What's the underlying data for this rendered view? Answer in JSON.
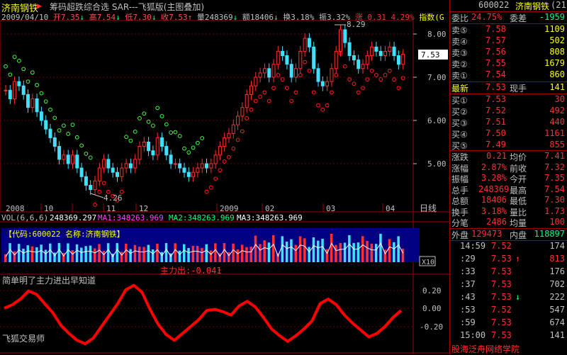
{
  "header": {
    "stock_name": "济南钢铁",
    "formula": "筹码超跌综合选 SAR---飞狐版(主图叠加)",
    "date": "2009/04/10",
    "open": "开7.35",
    "high": "高7.54",
    "low": "低7.30",
    "close": "收7.53",
    "volume": "量248369",
    "amount": "额18406",
    "turnover": "换3.18%",
    "amplitude": "振3.32%",
    "change": "涨 0.31 4.29%",
    "index": "指数(G"
  },
  "main_chart": {
    "ylabels": [
      "8.00",
      "7.00",
      "6.00",
      "5.00"
    ],
    "high_annotation": "8.29",
    "low_annotation": "4.26",
    "price_tag": "7.53",
    "x_labels": [
      "2008",
      "10",
      "11",
      "12",
      "2009",
      "02",
      "03",
      "04"
    ],
    "x_unit": "日线"
  },
  "volume_panel": {
    "title": "VOL(6,6,6)",
    "vol": "248369.297",
    "ma1": "MA1:348263.969",
    "ma2": "MA2:348263.969",
    "ma3": "MA3:348263.969",
    "code_label": "【代码:600022 名称:济南钢铁】",
    "scale": "X10"
  },
  "indicator_panel": {
    "title": "简单明了主力进出早知道",
    "value_label": "主力出:-0.041",
    "ylabels": [
      "0.20",
      "0.00",
      "-0.20"
    ],
    "footer": "飞狐交易师"
  },
  "chart_data": [
    {
      "type": "line",
      "title": "主力出",
      "y": [
        0.06,
        0.09,
        0.14,
        0.21,
        0.18,
        0.1,
        0.02,
        -0.09,
        -0.16,
        -0.22,
        -0.25,
        -0.2,
        -0.1,
        0.0,
        0.1,
        0.22,
        0.26,
        0.2,
        0.05,
        -0.08,
        -0.17,
        -0.22,
        -0.16,
        -0.1,
        -0.04,
        0.04,
        0.05,
        0.03,
        0.0,
        0.08,
        0.12,
        0.07,
        -0.02,
        -0.12,
        -0.18,
        -0.23,
        -0.18,
        -0.12,
        -0.05,
        0.1,
        0.14,
        0.09,
        0.0,
        -0.07,
        -0.13,
        -0.19,
        -0.16,
        -0.1,
        -0.02,
        0.04
      ],
      "ylim": [
        -0.28,
        0.35
      ]
    }
  ],
  "quote": {
    "code": "600022",
    "name": "济南钢铁",
    "num": "(21)",
    "webi_label": "委比",
    "webi_value": "24.75%",
    "wecha_label": "委差",
    "wecha_value": "-1959",
    "asks": [
      {
        "label": "卖⑤",
        "price": "7.58",
        "vol": "1109"
      },
      {
        "label": "卖④",
        "price": "7.57",
        "vol": "502"
      },
      {
        "label": "卖③",
        "price": "7.56",
        "vol": "808"
      },
      {
        "label": "卖②",
        "price": "7.55",
        "vol": "1679"
      },
      {
        "label": "卖①",
        "price": "7.54",
        "vol": "860"
      }
    ],
    "latest_label": "最新",
    "latest": "7.53",
    "hand_label": "现手",
    "hand": "141",
    "bids": [
      {
        "label": "买①",
        "price": "7.53",
        "vol": "30"
      },
      {
        "label": "买②",
        "price": "7.52",
        "vol": "492"
      },
      {
        "label": "买③",
        "price": "7.51",
        "vol": "440"
      },
      {
        "label": "买④",
        "price": "7.50",
        "vol": "1161"
      },
      {
        "label": "买⑤",
        "price": "7.49",
        "vol": "855"
      }
    ],
    "stats": [
      {
        "l1": "涨跌",
        "v1": "0.21",
        "l2": "均价",
        "v2": "7.41"
      },
      {
        "l1": "涨幅",
        "v1": "2.87%",
        "l2": "前收",
        "v2": "7.32"
      },
      {
        "l1": "振幅",
        "v1": "3.28%",
        "l2": "今开",
        "v2": "7.35"
      },
      {
        "l1": "总手",
        "v1": "248369",
        "l2": "最高",
        "v2": "7.54"
      },
      {
        "l1": "总额",
        "v1": "18406",
        "l2": "最低",
        "v2": "7.30"
      },
      {
        "l1": "换手",
        "v1": "3.18%",
        "l2": "量比",
        "v2": "1.73"
      },
      {
        "l1": "分笔",
        "v1": "2486",
        "l2": "均量",
        "v2": "100"
      }
    ],
    "outer_label": "外盘",
    "outer": "129473",
    "inner_label": "内盘",
    "inner": "118897",
    "ticks": [
      {
        "time": "14:59",
        "price": "7.52",
        "vol": "174",
        "arrow": ""
      },
      {
        "time": ":29",
        "price": "7.53",
        "vol": "813",
        "arrow": "↑"
      },
      {
        "time": ":33",
        "price": "7.53",
        "vol": "176",
        "arrow": ""
      },
      {
        "time": ":37",
        "price": "7.53",
        "vol": "702",
        "arrow": ""
      },
      {
        "time": ":43",
        "price": "7.53",
        "vol": "222",
        "arrow": "↓"
      },
      {
        "time": ":53",
        "price": "7.52",
        "vol": "547",
        "arrow": ""
      },
      {
        "time": ":59",
        "price": "7.53",
        "vol": "674",
        "arrow": ""
      },
      {
        "time": "15:00",
        "price": "7.53",
        "vol": "141",
        "arrow": ""
      }
    ],
    "watermark": "股海泛舟网络学院"
  }
}
